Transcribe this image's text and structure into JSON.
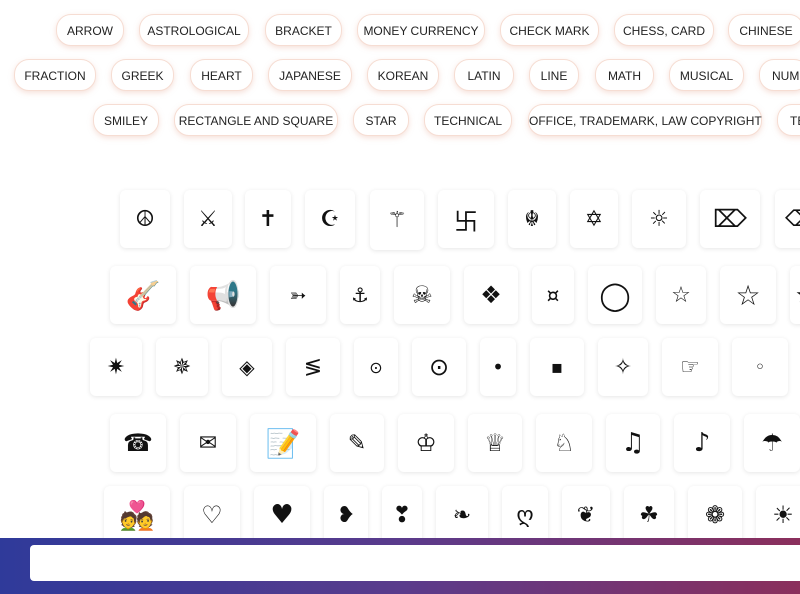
{
  "categories": {
    "row1": [
      "ARROW",
      "ASTROLOGICAL",
      "BRACKET",
      "MONEY CURRENCY",
      "CHECK MARK",
      "CHESS, CARD",
      "CHINESE"
    ],
    "row2": [
      "FRACTION",
      "GREEK",
      "HEART",
      "JAPANESE",
      "KOREAN",
      "LATIN",
      "LINE",
      "MATH",
      "MUSICAL",
      "NUM"
    ],
    "row3": [
      "SMILEY",
      "RECTANGLE AND SQUARE",
      "STAR",
      "TECHNICAL",
      "OFFICE, TRADEMARK, LAW COPYRIGHT",
      "TE"
    ]
  },
  "symbols": {
    "row1": [
      {
        "char": "☮",
        "name": "peace-symbol-icon"
      },
      {
        "char": "⚔",
        "name": "crossed-swords-icon"
      },
      {
        "char": "✝",
        "name": "latin-cross-icon"
      },
      {
        "char": "☪",
        "name": "star-and-crescent-icon"
      },
      {
        "char": "⚚",
        "name": "staff-of-hermes-icon"
      },
      {
        "char": "卐",
        "name": "swastika-icon"
      },
      {
        "char": "☬",
        "name": "khanda-icon"
      },
      {
        "char": "✡",
        "name": "star-of-david-icon"
      },
      {
        "char": "☼",
        "name": "sun-with-rays-icon"
      },
      {
        "char": "⌦",
        "name": "erase-to-the-right-icon"
      },
      {
        "char": "⌫",
        "name": "erase-to-the-left-icon"
      }
    ],
    "row2": [
      {
        "char": "🎸",
        "name": "guitar-icon"
      },
      {
        "char": "📢",
        "name": "loudspeaker-icon"
      },
      {
        "char": "➳",
        "name": "feathered-arrow-icon"
      },
      {
        "char": "⚓",
        "name": "anchor-icon"
      },
      {
        "char": "☠",
        "name": "skull-and-crossbones-icon"
      },
      {
        "char": "❖",
        "name": "diamond-minus-x-icon"
      },
      {
        "char": "¤",
        "name": "currency-sign-icon"
      },
      {
        "char": "◯",
        "name": "large-circle-icon"
      },
      {
        "char": "☆",
        "name": "small-white-star-icon"
      },
      {
        "char": "☆",
        "name": "white-star-icon"
      },
      {
        "char": "★",
        "name": "black-star-icon"
      }
    ],
    "row3": [
      {
        "char": "✷",
        "name": "eight-pointed-star-icon"
      },
      {
        "char": "✵",
        "name": "pinwheel-star-icon"
      },
      {
        "char": "◈",
        "name": "diamond-in-diamond-icon"
      },
      {
        "char": "≶",
        "name": "triple-stroke-icon"
      },
      {
        "char": "⊙",
        "name": "small-circled-dot-icon"
      },
      {
        "char": "⊙",
        "name": "circled-dot-icon"
      },
      {
        "char": "•",
        "name": "bullet-icon"
      },
      {
        "char": "▪",
        "name": "small-black-square-icon"
      },
      {
        "char": "✧",
        "name": "four-pointed-star-icon"
      },
      {
        "char": "☞",
        "name": "pointing-hand-icon"
      },
      {
        "char": "◦",
        "name": "white-bullet-icon"
      }
    ],
    "row4": [
      {
        "char": "☎",
        "name": "telephone-icon"
      },
      {
        "char": "✉",
        "name": "envelope-icon"
      },
      {
        "char": "📝",
        "name": "memo-icon"
      },
      {
        "char": "✎",
        "name": "pencil-icon"
      },
      {
        "char": "♔",
        "name": "white-king-icon"
      },
      {
        "char": "♕",
        "name": "white-queen-icon"
      },
      {
        "char": "♘",
        "name": "white-knight-icon"
      },
      {
        "char": "♫",
        "name": "beamed-notes-icon"
      },
      {
        "char": "♪",
        "name": "eighth-note-icon"
      },
      {
        "char": "☂",
        "name": "umbrella-icon"
      }
    ],
    "row5": [
      {
        "char": "💑",
        "name": "couple-with-heart-icon"
      },
      {
        "char": "♡",
        "name": "white-heart-icon"
      },
      {
        "char": "♥",
        "name": "black-heart-icon"
      },
      {
        "char": "❥",
        "name": "rotated-heart-icon"
      },
      {
        "char": "❣",
        "name": "heart-exclamation-icon"
      },
      {
        "char": "❧",
        "name": "floral-heart-icon"
      },
      {
        "char": "ღ",
        "name": "georgian-heart-icon"
      },
      {
        "char": "❦",
        "name": "floral-heart-bullet-icon"
      },
      {
        "char": "☘",
        "name": "shamrock-icon"
      },
      {
        "char": "❁",
        "name": "eight-petal-flower-icon"
      },
      {
        "char": "☀",
        "name": "black-sun-icon"
      }
    ]
  },
  "search": {
    "placeholder": ""
  }
}
